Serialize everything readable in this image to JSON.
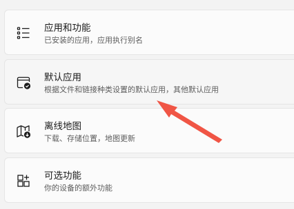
{
  "items": [
    {
      "title": "应用和功能",
      "desc": "已安装的应用，应用执行别名",
      "icon": "apps-list-icon"
    },
    {
      "title": "默认应用",
      "desc": "根据文件和链接种类设置的默认应用，其他默认应用",
      "icon": "default-apps-icon"
    },
    {
      "title": "离线地图",
      "desc": "下载、存储位置，地图更新",
      "icon": "offline-map-icon"
    },
    {
      "title": "可选功能",
      "desc": "你的设备的额外功能",
      "icon": "optional-features-icon"
    }
  ],
  "annotation": {
    "arrow_color": "#f05545"
  }
}
